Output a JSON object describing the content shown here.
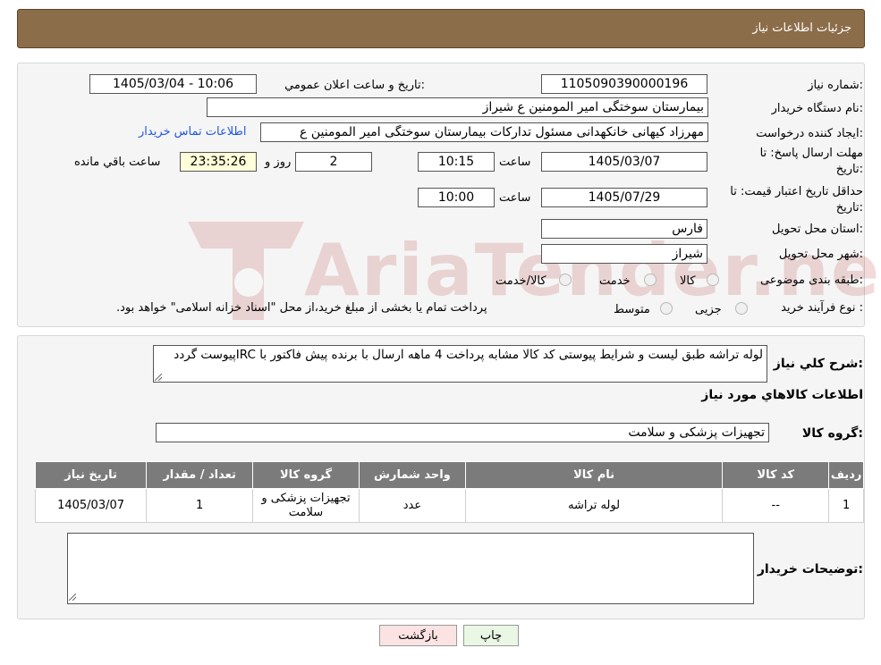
{
  "header": {
    "title": "جزئیات اطلاعات نیاز"
  },
  "form": {
    "need_number_label": "شماره نیاز:",
    "need_number": "1105090390000196",
    "announce_label": "تاریخ و ساعت اعلان عمومي:",
    "announce_value": "1405/03/04 - 10:06",
    "buyer_org_label": "نام دستگاه خریدار:",
    "buyer_org": "بیمارستان سوختگی امیر المومنین  ع  شیراز",
    "creator_label": "ایجاد کننده درخواست:",
    "creator": "مهرزاد کیهانی خانکهدانی مسئول تدارکات بیمارستان سوختگی امیر المومنین  ع",
    "contact_link": "اطلاعات تماس خریدار",
    "deadline_label_1": "مهلت ارسال پاسخ: تا",
    "deadline_label_2": "تاریخ:",
    "deadline_date": "1405/03/07",
    "time_label": "ساعت",
    "deadline_time": "10:15",
    "days_value": "2",
    "days_label": "روز و",
    "remaining_time": "23:35:26",
    "remaining_label": "ساعت باقي مانده",
    "validity_label_1": "حداقل تاریخ اعتبار قیمت: تا",
    "validity_label_2": "تاریخ:",
    "validity_date": "1405/07/29",
    "validity_time_label": "ساعت",
    "validity_time": "10:00",
    "province_label": "استان محل تحویل:",
    "province": "فارس",
    "city_label": "شهر محل تحویل:",
    "city": "شیراز",
    "category_label": "طبقه بندی موضوعی:",
    "category_options": [
      "کالا",
      "خدمت",
      "کالا/خدمت"
    ],
    "process_label": "نوع فرآیند خرید :",
    "process_options": [
      "جزیی",
      "متوسط"
    ],
    "process_note": "پرداخت تمام یا بخشی از مبلغ خرید،از محل \"اسناد خزانه اسلامی\" خواهد بود."
  },
  "description": {
    "label": "شرح کلي نیاز:",
    "text": "لوله تراشه طبق لیست و شرایط پیوستی کد کالا مشابه پرداخت 4 ماهه ارسال با برنده پیش فاکتور با IRCپیوست گردد"
  },
  "goods_info": {
    "title": "اطلاعات کالاهاي مورد نیاز",
    "group_label": "گروه کالا:",
    "group_value": "تجهیزات پزشکی و سلامت"
  },
  "table": {
    "headers": [
      "ردیف",
      "کد کالا",
      "نام کالا",
      "واحد شمارش",
      "گروه کالا",
      "تعداد / مقدار",
      "تاریخ نیاز"
    ],
    "rows": [
      [
        "1",
        "--",
        "لوله تراشه",
        "عدد",
        "تجهیزات پزشکی و سلامت",
        "1",
        "1405/03/07"
      ]
    ]
  },
  "buyer_notes": {
    "label": "توضیحات خریدار:",
    "text": ""
  },
  "buttons": {
    "print": "چاپ",
    "back": "بازگشت"
  },
  "watermark": {
    "text": "AriaTender.neT"
  },
  "colors": {
    "header": "#8c6d4a",
    "print_button": "#e9f7e4",
    "back_button": "#fbe3e3",
    "link": "#2255dd"
  }
}
